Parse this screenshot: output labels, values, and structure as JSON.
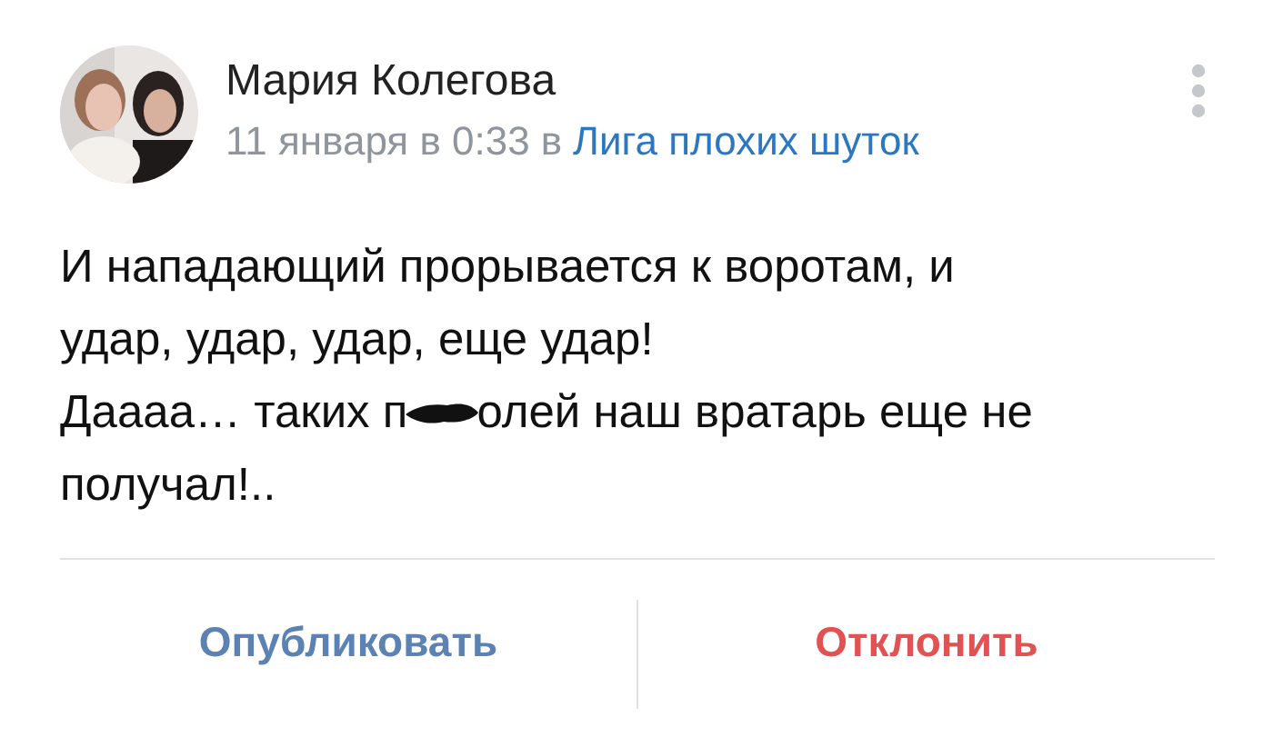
{
  "post": {
    "author": "Мария Колегова",
    "date": "11 января в 0:33",
    "preposition": "в",
    "community": "Лига плохих шуток",
    "body_lines": [
      {
        "text": "И нападающий прорывается к воротам, и",
        "redacted": false
      },
      {
        "text": "удар, удар, удар, еще удар!",
        "redacted": false
      },
      {
        "text": "Даааа… таких п",
        "redacted": true,
        "text_after": "олей наш вратарь еще не"
      },
      {
        "text": "получал!..",
        "redacted": false
      }
    ]
  },
  "actions": [
    {
      "label": "Опубликовать",
      "kind": "primary"
    },
    {
      "label": "Отклонить",
      "kind": "danger"
    }
  ]
}
